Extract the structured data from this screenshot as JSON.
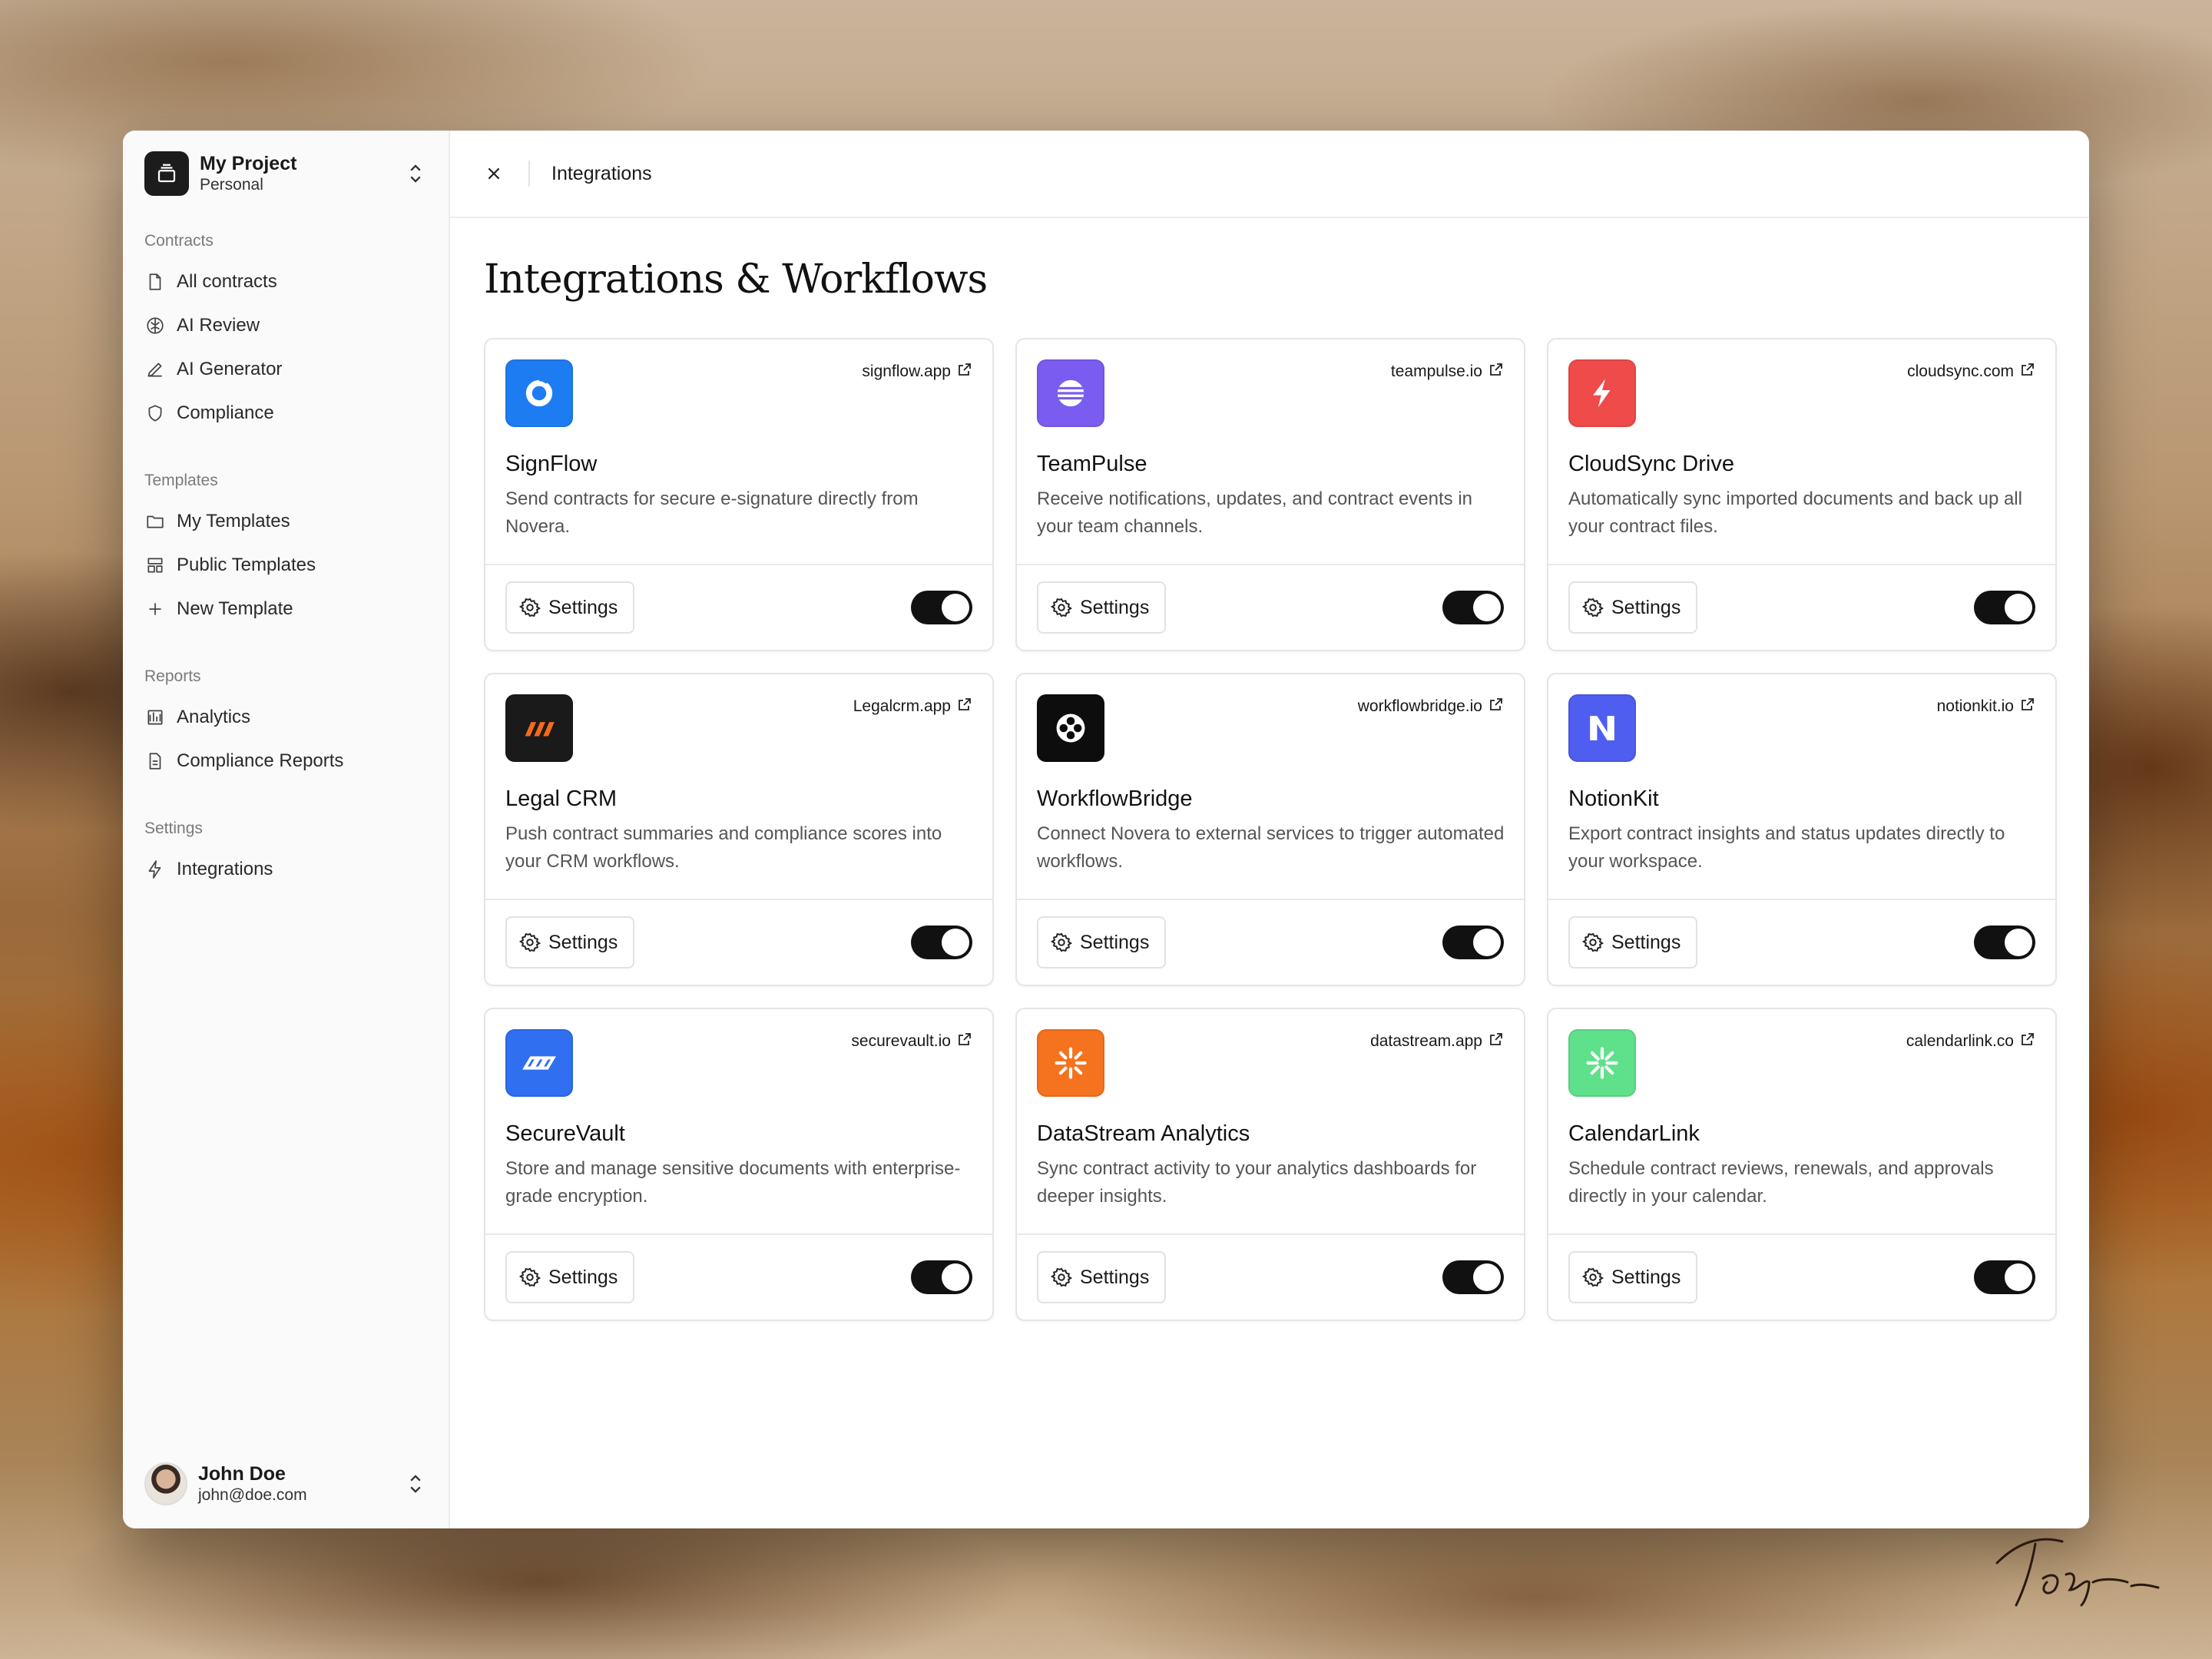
{
  "project": {
    "name": "My Project",
    "subtitle": "Personal"
  },
  "sidebar": {
    "sections": [
      {
        "label": "Contracts",
        "items": [
          {
            "label": "All contracts",
            "icon": "file-icon"
          },
          {
            "label": "AI Review",
            "icon": "brain-icon"
          },
          {
            "label": "AI Generator",
            "icon": "pen-icon"
          },
          {
            "label": "Compliance",
            "icon": "shield-icon"
          }
        ]
      },
      {
        "label": "Templates",
        "items": [
          {
            "label": "My Templates",
            "icon": "folder-icon"
          },
          {
            "label": "Public Templates",
            "icon": "layout-icon"
          },
          {
            "label": "New Template",
            "icon": "plus-icon"
          }
        ]
      },
      {
        "label": "Reports",
        "items": [
          {
            "label": "Analytics",
            "icon": "bar-chart-icon"
          },
          {
            "label": "Compliance Reports",
            "icon": "report-icon"
          }
        ]
      },
      {
        "label": "Settings",
        "items": [
          {
            "label": "Integrations",
            "icon": "bolt-icon"
          }
        ]
      }
    ]
  },
  "user": {
    "name": "John Doe",
    "email": "john@doe.com"
  },
  "topbar": {
    "title": "Integrations"
  },
  "page": {
    "title": "Integrations & Workflows"
  },
  "settings_label": "Settings",
  "integrations": [
    {
      "name": "SignFlow",
      "link": "signflow.app",
      "desc": "Send contracts for secure e-signature directly from Novera.",
      "color": "#1e7cf2",
      "icon": "signflow-logo-icon",
      "enabled": true
    },
    {
      "name": "TeamPulse",
      "link": "teampulse.io",
      "desc": "Receive notifications, updates, and contract events in your team channels.",
      "color": "#7b5cf0",
      "icon": "teampulse-logo-icon",
      "enabled": true
    },
    {
      "name": "CloudSync Drive",
      "link": "cloudsync.com",
      "desc": "Automatically sync imported documents and back up all your contract files.",
      "color": "#ef4b4b",
      "icon": "cloudsync-logo-icon",
      "enabled": true
    },
    {
      "name": "Legal CRM",
      "link": "Legalcrm.app",
      "desc": "Push contract summaries and compliance scores into your CRM workflows.",
      "color": "#1a1a1a",
      "icon": "legalcrm-logo-icon",
      "enabled": true
    },
    {
      "name": "WorkflowBridge",
      "link": "workflowbridge.io",
      "desc": "Connect Novera to external services to trigger automated workflows.",
      "color": "#0d0d0d",
      "icon": "workflowbridge-logo-icon",
      "enabled": true
    },
    {
      "name": "NotionKit",
      "link": "notionkit.io",
      "desc": "Export contract insights and status updates directly to your workspace.",
      "color": "#4f5ef0",
      "icon": "notionkit-logo-icon",
      "enabled": true
    },
    {
      "name": "SecureVault",
      "link": "securevault.io",
      "desc": "Store and manage sensitive documents with enterprise-grade encryption.",
      "color": "#2f6ff0",
      "icon": "securevault-logo-icon",
      "enabled": true
    },
    {
      "name": "DataStream Analytics",
      "link": "datastream.app",
      "desc": "Sync contract activity to your analytics dashboards for deeper insights.",
      "color": "#f5731e",
      "icon": "datastream-logo-icon",
      "enabled": true
    },
    {
      "name": "CalendarLink",
      "link": "calendarlink.co",
      "desc": "Schedule contract reviews, renewals, and approvals directly in your calendar.",
      "color": "#5fe08a",
      "icon": "calendarlink-logo-icon",
      "enabled": true
    }
  ]
}
